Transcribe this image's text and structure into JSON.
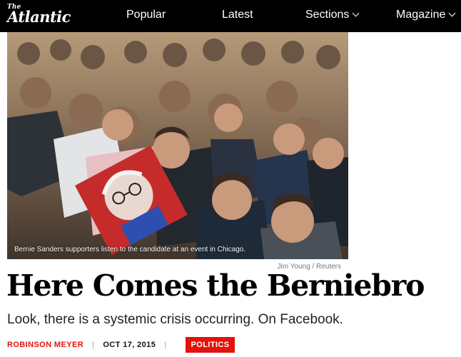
{
  "header": {
    "logo_small": "The",
    "logo_name": "Atlantic",
    "nav": [
      {
        "label": "Popular"
      },
      {
        "label": "Latest"
      },
      {
        "label": "Sections"
      },
      {
        "label": "Magazine"
      }
    ]
  },
  "hero": {
    "caption": "Bernie Sanders supporters listen to the candidate at an event in Chicago.",
    "credit": "Jim Young / Reuters"
  },
  "article": {
    "headline": "Here Comes the Berniebro",
    "dek": "Look, there is a systemic crisis occurring. On Facebook.",
    "author": "ROBINSON MEYER",
    "separator": "|",
    "date": "OCT 17, 2015",
    "section_tag": "POLITICS"
  },
  "colors": {
    "topbar": "#000000",
    "accent_red": "#e3120b",
    "text": "#000000"
  }
}
